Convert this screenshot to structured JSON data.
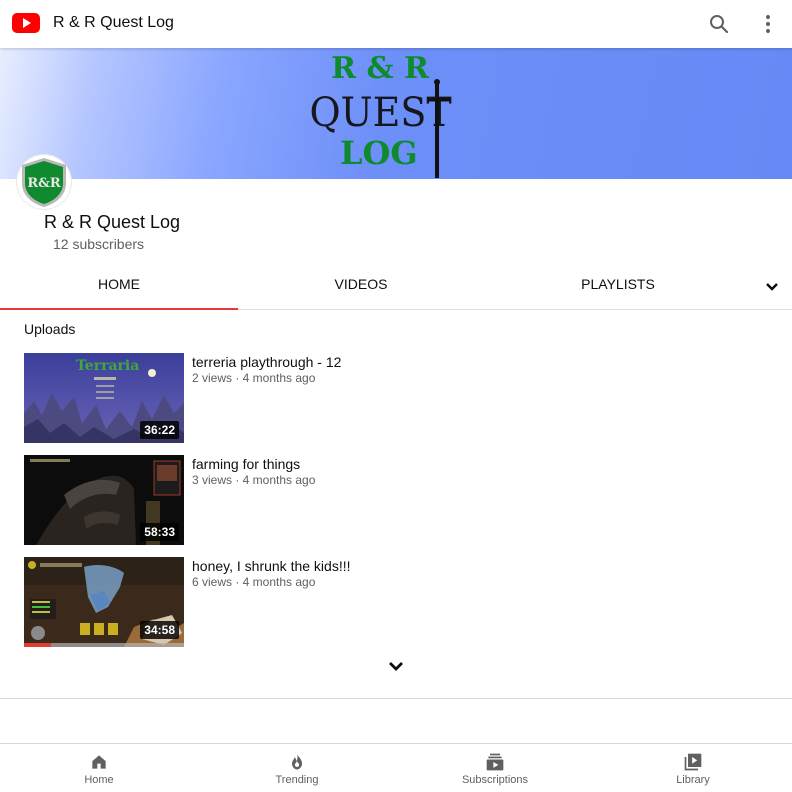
{
  "topbar": {
    "title": "R & R Quest Log"
  },
  "banner": {
    "line1": "R & R",
    "line2": "QUEST",
    "line3": "LOG"
  },
  "channel": {
    "name": "R & R Quest Log",
    "subscribers": "12 subscribers",
    "avatar_text": "R&R"
  },
  "tabs": [
    {
      "label": "HOME",
      "active": true
    },
    {
      "label": "VIDEOS",
      "active": false
    },
    {
      "label": "PLAYLISTS",
      "active": false
    }
  ],
  "uploads": {
    "section_title": "Uploads",
    "videos": [
      {
        "title": "terreria playthrough - 12",
        "meta": "2 views · 4 months ago",
        "duration": "36:22",
        "thumb_text": "Terraria",
        "progress": 0
      },
      {
        "title": "farming for things",
        "meta": "3 views · 4 months ago",
        "duration": "58:33",
        "progress": 0
      },
      {
        "title": "honey, I shrunk the kids!!!",
        "meta": "6 views · 4 months ago",
        "duration": "34:58",
        "progress": 0.17
      }
    ]
  },
  "bottom_nav": [
    {
      "label": "Home",
      "icon": "home-icon"
    },
    {
      "label": "Trending",
      "icon": "flame-icon"
    },
    {
      "label": "Subscriptions",
      "icon": "subscriptions-icon"
    },
    {
      "label": "Library",
      "icon": "library-icon"
    }
  ],
  "colors": {
    "accent_red": "#e53935",
    "youtube_red": "#ff0000",
    "banner_blue": "#6689f5",
    "logo_green": "#0f8a2e"
  }
}
